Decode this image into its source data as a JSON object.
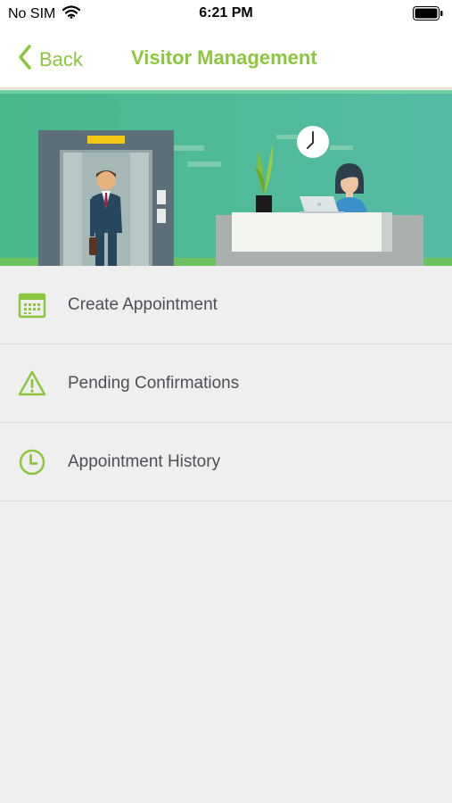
{
  "status_bar": {
    "carrier": "No SIM",
    "time": "6:21 PM",
    "icons": [
      "wifi-icon",
      "battery-icon"
    ]
  },
  "nav": {
    "back_label": "Back",
    "title": "Visitor Management",
    "accent_color": "#8cc63f",
    "icons": [
      "chevron-left-icon"
    ]
  },
  "banner": {
    "illustration": "reception-desk-elevator-illustration",
    "background_color": "#4db892"
  },
  "menu": {
    "items": [
      {
        "label": "Create Appointment",
        "icon": "calendar-icon"
      },
      {
        "label": "Pending Confirmations",
        "icon": "warning-icon"
      },
      {
        "label": "Appointment History",
        "icon": "clock-icon"
      }
    ],
    "icon_color": "#8cc63f",
    "text_color": "#4a4f55"
  }
}
